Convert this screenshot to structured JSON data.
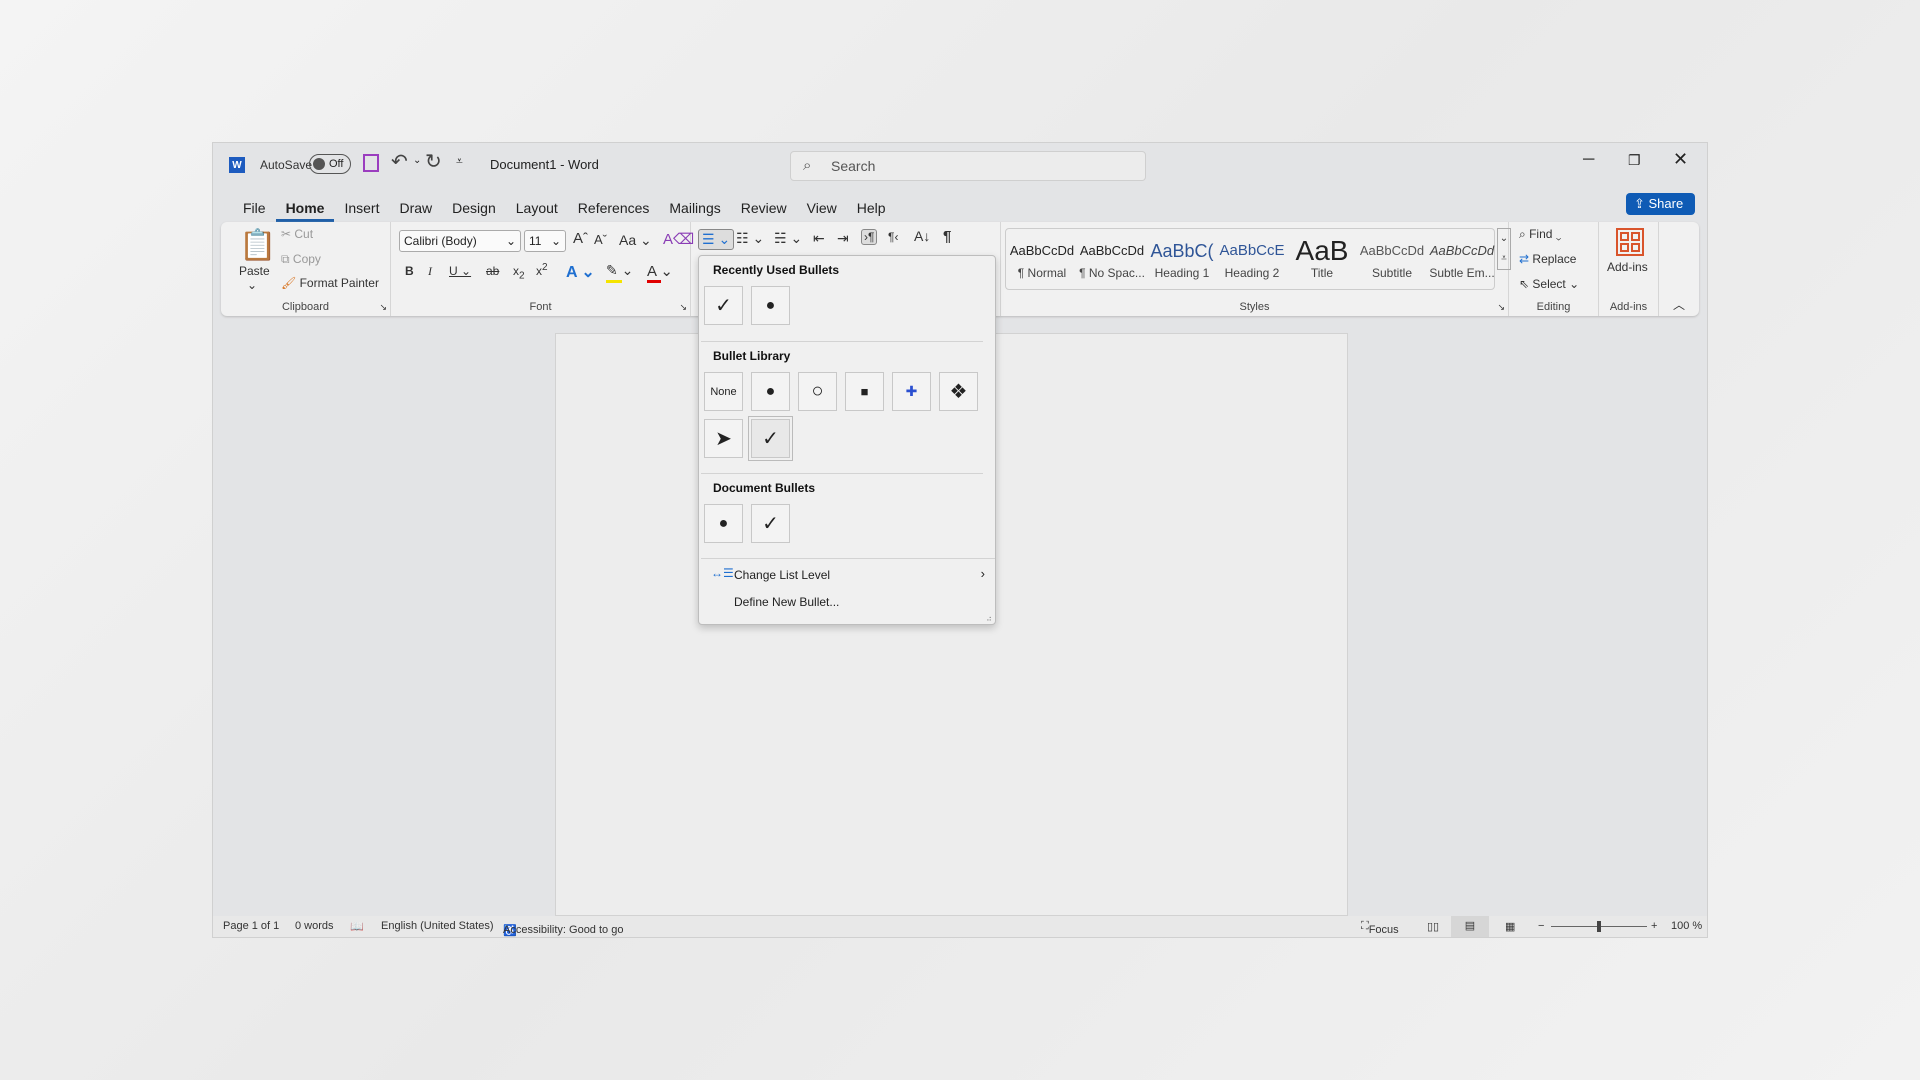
{
  "titlebar": {
    "autosave_label": "AutoSave",
    "autosave_state": "Off",
    "doc_title": "Document1 - Word",
    "search_placeholder": "Search"
  },
  "tabs": [
    "File",
    "Home",
    "Insert",
    "Draw",
    "Design",
    "Layout",
    "References",
    "Mailings",
    "Review",
    "View",
    "Help"
  ],
  "active_tab": "Home",
  "share_label": "Share",
  "clipboard": {
    "paste": "Paste",
    "cut": "Cut",
    "copy": "Copy",
    "format_painter": "Format Painter",
    "label": "Clipboard"
  },
  "font": {
    "name": "Calibri (Body)",
    "size": "11",
    "case": "Aa",
    "label": "Font",
    "highlight_color": "#f5e400",
    "font_color": "#e00000"
  },
  "styles": {
    "label": "Styles",
    "items": [
      {
        "preview": "AaBbCcDd",
        "name": "¶ Normal"
      },
      {
        "preview": "AaBbCcDd",
        "name": "¶ No Spac..."
      },
      {
        "preview": "AaBbC(",
        "name": "Heading 1"
      },
      {
        "preview": "AaBbCcE",
        "name": "Heading 2"
      },
      {
        "preview": "AaB",
        "name": "Title"
      },
      {
        "preview": "AaBbCcDd",
        "name": "Subtitle"
      },
      {
        "preview": "AaBbCcDd",
        "name": "Subtle Em..."
      }
    ]
  },
  "editing": {
    "find": "Find",
    "replace": "Replace",
    "select": "Select",
    "label": "Editing"
  },
  "addins": {
    "button": "Add-ins",
    "label": "Add-ins",
    "color": "#d9542b"
  },
  "bullets_menu": {
    "recent_title": "Recently Used Bullets",
    "recent": [
      "✓",
      "●"
    ],
    "library_title": "Bullet Library",
    "library": [
      "None",
      "●",
      "○",
      "■",
      "✚",
      "❖",
      "➤",
      "✓"
    ],
    "document_title": "Document Bullets",
    "document": [
      "●",
      "✓"
    ],
    "change_level": "Change List Level",
    "define_new": "Define New Bullet..."
  },
  "status": {
    "page": "Page 1 of 1",
    "words": "0 words",
    "language": "English (United States)",
    "accessibility": "Accessibility: Good to go",
    "focus": "Focus",
    "zoom": "100 %",
    "zoom_level_percent": 100
  },
  "accent": "#1f5fa8"
}
